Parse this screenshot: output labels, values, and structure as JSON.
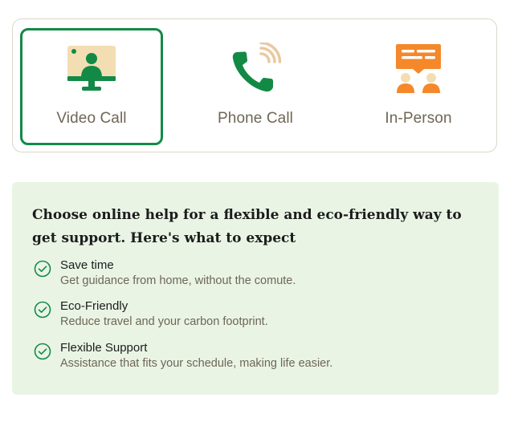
{
  "options": {
    "selected": "video",
    "items": [
      {
        "id": "video",
        "label": "Video Call",
        "icon": "video-call-icon"
      },
      {
        "id": "phone",
        "label": "Phone Call",
        "icon": "phone-call-icon"
      },
      {
        "id": "inperson",
        "label": "In-Person",
        "icon": "in-person-icon"
      }
    ]
  },
  "info": {
    "title": "Choose online help for a flexible and eco-friendly way to get support. Here's what to expect",
    "benefits": [
      {
        "title": "Save time",
        "description": "Get guidance from home, without the comute."
      },
      {
        "title": "Eco-Friendly",
        "description": "Reduce travel and your carbon footprint."
      },
      {
        "title": "Flexible Support",
        "description": "Assistance that fits your schedule, making life easier."
      }
    ]
  },
  "colors": {
    "accent_green": "#128a46",
    "panel_background": "#e9f4e5",
    "icon_orange": "#f5882a",
    "icon_beige": "#f3deb3",
    "label_gray": "#6f6656"
  }
}
